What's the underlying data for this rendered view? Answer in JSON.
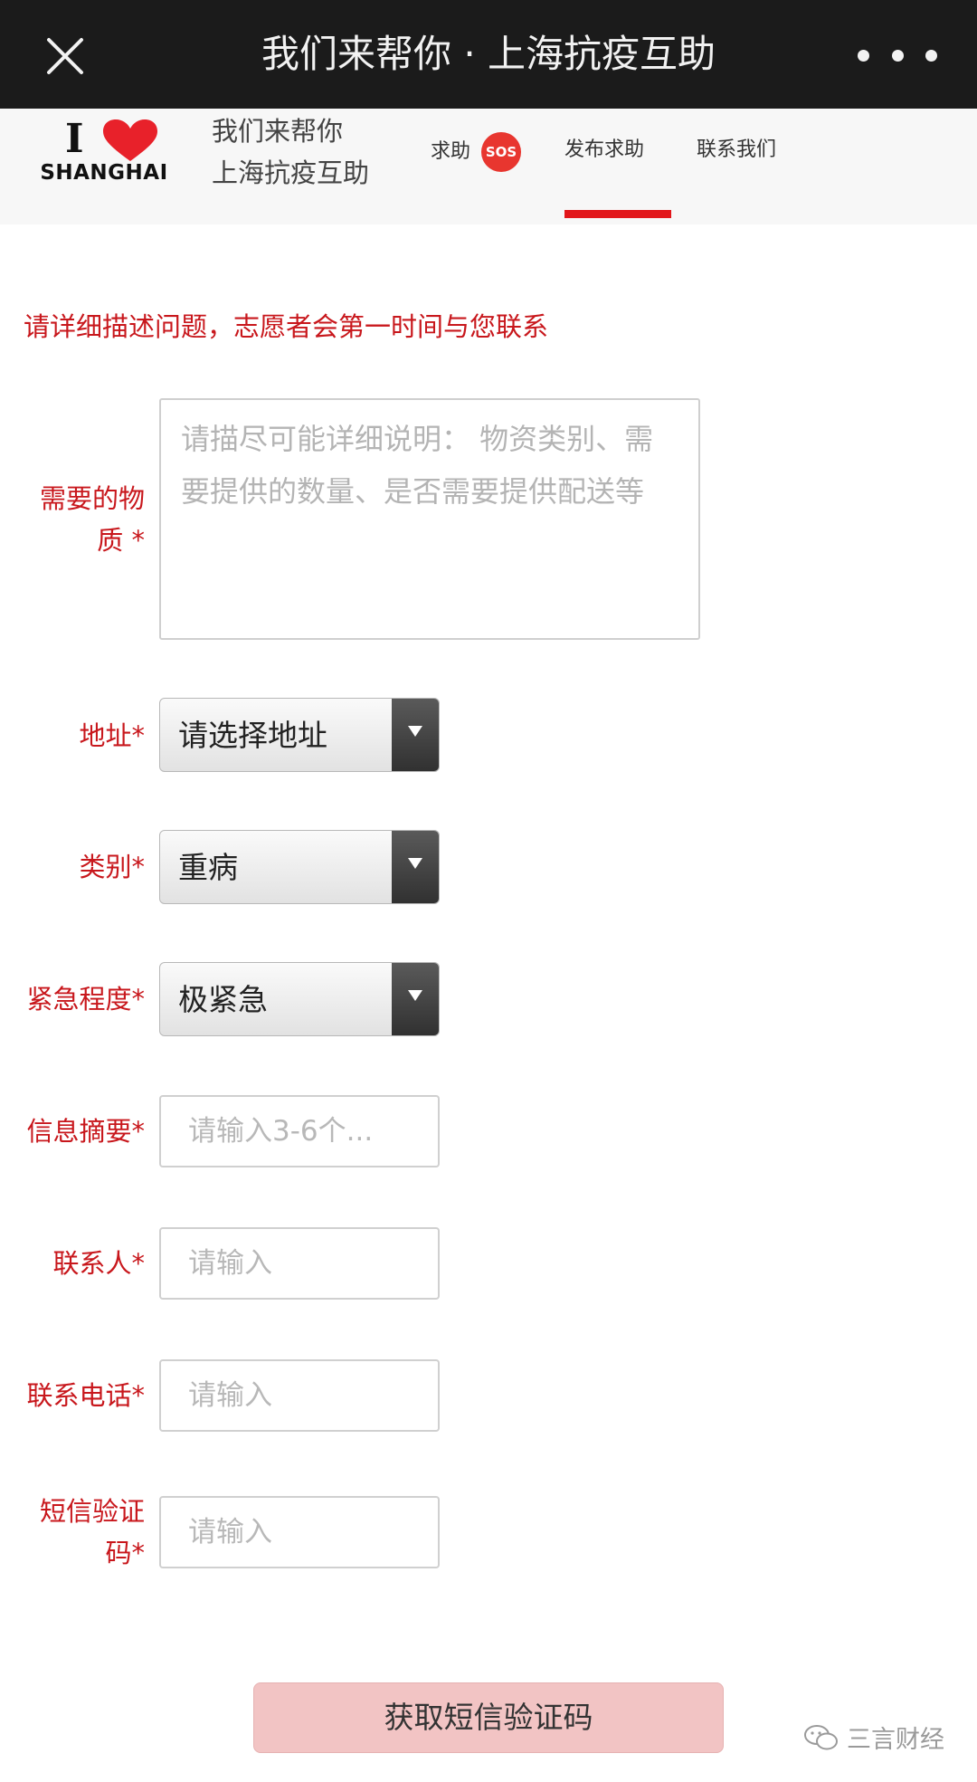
{
  "titlebar": {
    "title": "我们来帮你 · 上海抗疫互助"
  },
  "header": {
    "logo_i": "I",
    "logo_city": "SHANGHAI",
    "brand_line1": "我们来帮你",
    "brand_line2": "上海抗疫互助",
    "nav": {
      "help": "求助",
      "sos": "SOS",
      "post": "发布求助",
      "contact": "联系我们"
    }
  },
  "form": {
    "intro": "请详细描述问题，志愿者会第一时间与您联系",
    "materials": {
      "label_line1": "需要的物",
      "label_line2": "质 *",
      "placeholder": "请描尽可能详细说明： 物资类别、需要提供的数量、是否需要提供配送等"
    },
    "address": {
      "label": "地址*",
      "value": "请选择地址"
    },
    "category": {
      "label": "类别*",
      "value": "重病"
    },
    "urgency": {
      "label": "紧急程度*",
      "value": "极紧急"
    },
    "summary": {
      "label": "信息摘要*",
      "placeholder": "请输入3-6个..."
    },
    "contact_person": {
      "label": "联系人*",
      "placeholder": "请输入"
    },
    "phone": {
      "label": "联系电话*",
      "placeholder": "请输入"
    },
    "sms_code": {
      "label_line1": "短信验证",
      "label_line2": "码*",
      "placeholder": "请输入"
    },
    "sms_button": "获取短信验证码"
  },
  "watermark": "三言财经",
  "colors": {
    "accent_red": "#c8171c",
    "titlebar_bg": "#1b1b1b",
    "sos_red": "#e8362f",
    "button_pink": "#f2c4c4"
  }
}
